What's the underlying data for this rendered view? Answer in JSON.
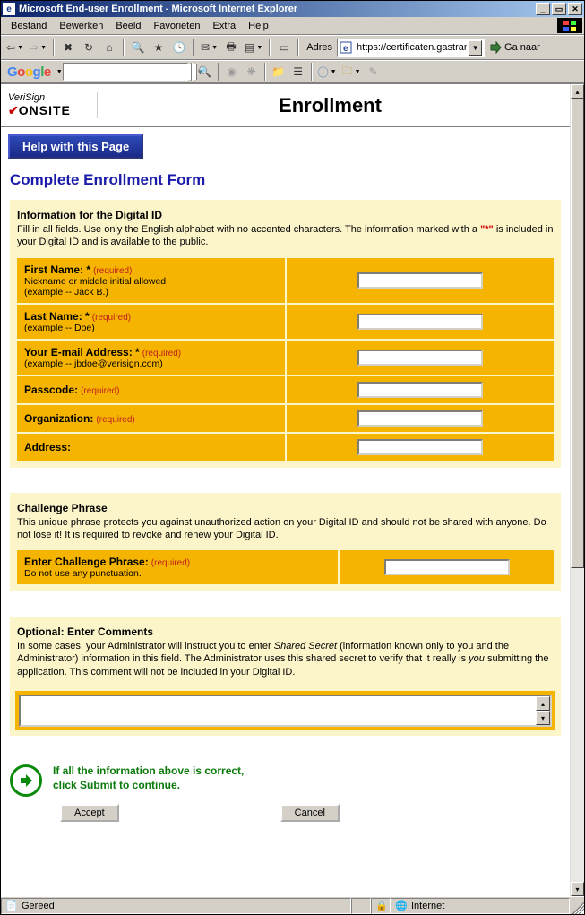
{
  "window": {
    "title": "Microsoft End-user Enrollment - Microsoft Internet Explorer"
  },
  "menubar": {
    "items": [
      "Bestand",
      "Bewerken",
      "Beeld",
      "Favorieten",
      "Extra",
      "Help"
    ]
  },
  "toolbar": {
    "address_label": "Adres",
    "address_value": "https://certificaten.gastran",
    "go_label": "Ga naar"
  },
  "google": {
    "search_value": ""
  },
  "page": {
    "logo_top": "VeriSign",
    "logo_bottom": "ONSITE",
    "title": "Enrollment",
    "help_button": "Help with this Page",
    "form_title": "Complete Enrollment Form"
  },
  "section_info": {
    "title": "Information for the Digital ID",
    "desc_pre": "Fill in all fields. Use only the English alphabet with no accented characters. The information marked with a ",
    "desc_mark": "\"*\"",
    "desc_post": " is included in your Digital ID and is available to the public.",
    "fields": [
      {
        "label": "First Name: *",
        "req": "(required)",
        "hint1": "Nickname or middle initial allowed",
        "hint2": "(example -- Jack B.)",
        "value": ""
      },
      {
        "label": "Last Name: *",
        "req": "(required)",
        "hint1": "(example -- Doe)",
        "hint2": "",
        "value": ""
      },
      {
        "label": "Your E-mail Address: *",
        "req": "(required)",
        "hint1": "(example -- jbdoe@verisign.com)",
        "hint2": "",
        "value": ""
      },
      {
        "label": "Passcode:",
        "req": "(required)",
        "hint1": "",
        "hint2": "",
        "value": ""
      },
      {
        "label": "Organization:",
        "req": "(required)",
        "hint1": "",
        "hint2": "",
        "value": ""
      },
      {
        "label": "Address:",
        "req": "",
        "hint1": "",
        "hint2": "",
        "value": ""
      }
    ]
  },
  "section_challenge": {
    "title": "Challenge Phrase",
    "desc": "This unique phrase protects you against unauthorized action on your Digital ID and should not be shared with anyone. Do not lose it! It is required to revoke and renew your Digital ID.",
    "field_label": "Enter Challenge Phrase:",
    "field_req": "(required)",
    "field_hint": "Do not use any punctuation.",
    "value": ""
  },
  "section_comments": {
    "title": "Optional: Enter Comments",
    "desc_pre": "In some cases, your Administrator will instruct you to enter ",
    "desc_italic": "Shared Secret",
    "desc_mid": " (information known only to you and the Administrator) information in this field. The Administrator uses this shared secret to verify that it really is ",
    "desc_italic2": "you",
    "desc_post": " submitting the application. This comment will not be included in your Digital ID.",
    "value": ""
  },
  "submit": {
    "line1": "If all the information above is correct,",
    "line2": "click Submit to continue.",
    "accept": "Accept",
    "cancel": "Cancel"
  },
  "statusbar": {
    "status": "Gereed",
    "zone": "Internet"
  }
}
